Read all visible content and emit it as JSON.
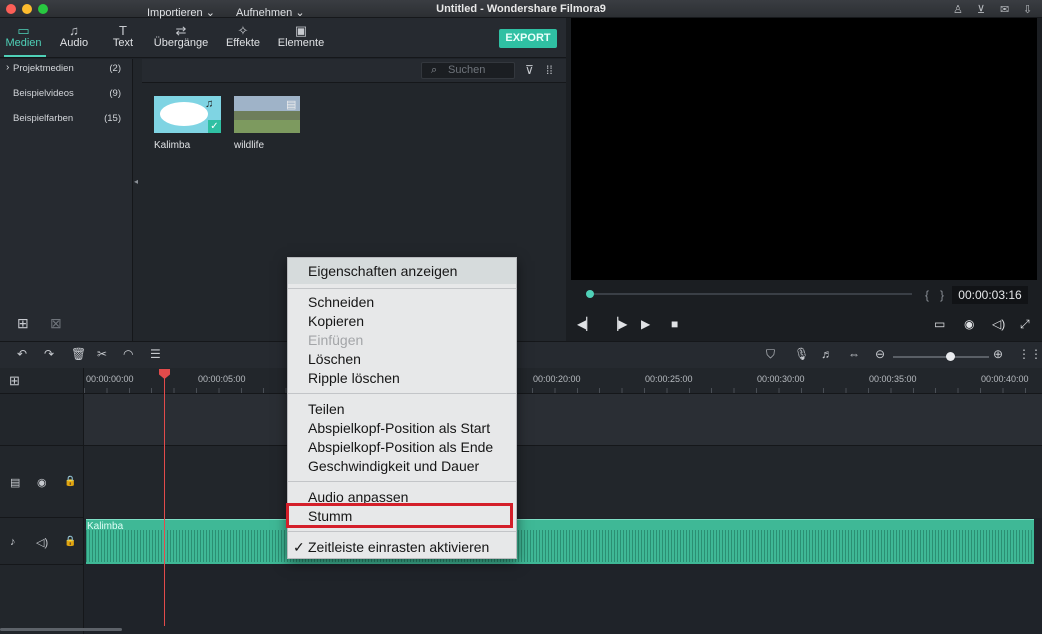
{
  "window": {
    "title": "Untitled - Wondershare Filmora9"
  },
  "tabs": [
    {
      "label": "Medien",
      "icon": "folder-icon"
    },
    {
      "label": "Audio",
      "icon": "music-note-icon"
    },
    {
      "label": "Text",
      "icon": "text-icon"
    },
    {
      "label": "Übergänge",
      "icon": "transition-icon"
    },
    {
      "label": "Effekte",
      "icon": "effects-icon"
    },
    {
      "label": "Elemente",
      "icon": "image-icon"
    }
  ],
  "export_label": "EXPORT",
  "library": [
    {
      "label": "Projektmedien",
      "count": "(2)"
    },
    {
      "label": "Beispielvideos",
      "count": "(9)"
    },
    {
      "label": "Beispielfarben",
      "count": "(15)"
    }
  ],
  "media_toolbar": {
    "import": "Importieren",
    "record": "Aufnehmen",
    "search_placeholder": "Suchen"
  },
  "media": [
    {
      "name": "Kalimba"
    },
    {
      "name": "wildlife"
    }
  ],
  "preview": {
    "timecode": "00:00:03:16"
  },
  "ruler": [
    "00:00:00:00",
    "00:00:05:00",
    "00:00:20:00",
    "00:00:25:00",
    "00:00:30:00",
    "00:00:35:00",
    "00:00:40:00"
  ],
  "audio_clip": {
    "name": "Kalimba"
  },
  "context_menu": {
    "header": "Eigenschaften anzeigen",
    "items": [
      "Schneiden",
      "Kopieren",
      "Einfügen",
      "Löschen",
      "Ripple löschen",
      "Teilen",
      "Abspielkopf-Position als Start",
      "Abspielkopf-Position als Ende",
      "Geschwindigkeit und Dauer",
      "Audio anpassen",
      "Stumm",
      "Zeitleiste einrasten aktivieren"
    ],
    "check": "✓"
  },
  "colors": {
    "accent": "#4fd1b8",
    "highlight": "#d41f2a"
  }
}
